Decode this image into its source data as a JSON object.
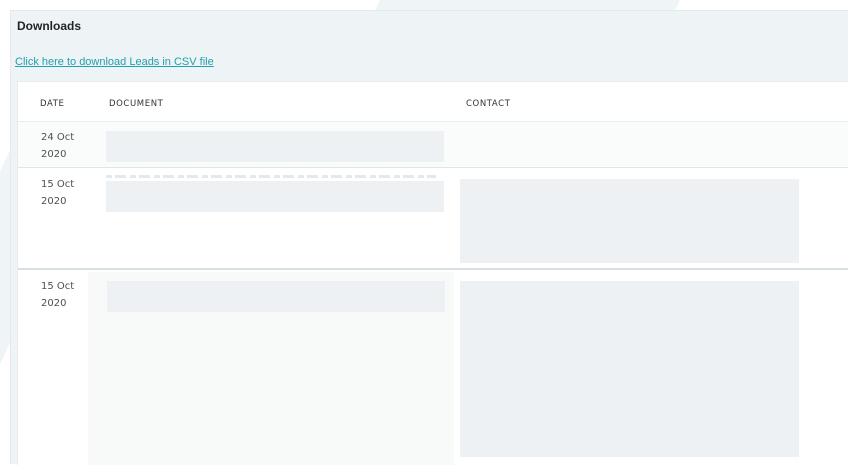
{
  "downloads": {
    "title": "Downloads",
    "csv_link_label": "Click here to download Leads in CSV file"
  },
  "table": {
    "columns": [
      "DATE",
      "DOCUMENT",
      "CONTACT"
    ],
    "rows": [
      {
        "date_line1": "24 Oct",
        "date_line2": "2020"
      },
      {
        "date_line1": "15 Oct",
        "date_line2": "2020"
      },
      {
        "date_line1": "15 Oct",
        "date_line2": "2020"
      }
    ]
  },
  "colors": {
    "link": "#21a0ad",
    "panel_background": "#eef3f5",
    "redaction": "#edf1f3"
  }
}
